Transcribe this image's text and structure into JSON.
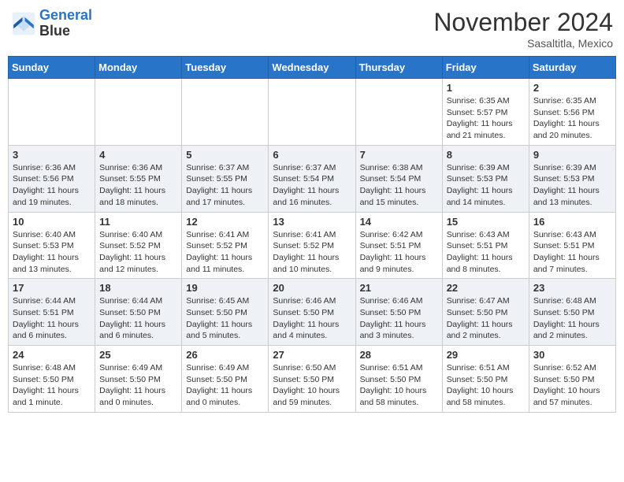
{
  "logo": {
    "line1": "General",
    "line2": "Blue"
  },
  "title": "November 2024",
  "subtitle": "Sasaltitla, Mexico",
  "days_of_week": [
    "Sunday",
    "Monday",
    "Tuesday",
    "Wednesday",
    "Thursday",
    "Friday",
    "Saturday"
  ],
  "weeks": [
    [
      {
        "day": "",
        "info": ""
      },
      {
        "day": "",
        "info": ""
      },
      {
        "day": "",
        "info": ""
      },
      {
        "day": "",
        "info": ""
      },
      {
        "day": "",
        "info": ""
      },
      {
        "day": "1",
        "info": "Sunrise: 6:35 AM\nSunset: 5:57 PM\nDaylight: 11 hours and 21 minutes."
      },
      {
        "day": "2",
        "info": "Sunrise: 6:35 AM\nSunset: 5:56 PM\nDaylight: 11 hours and 20 minutes."
      }
    ],
    [
      {
        "day": "3",
        "info": "Sunrise: 6:36 AM\nSunset: 5:56 PM\nDaylight: 11 hours and 19 minutes."
      },
      {
        "day": "4",
        "info": "Sunrise: 6:36 AM\nSunset: 5:55 PM\nDaylight: 11 hours and 18 minutes."
      },
      {
        "day": "5",
        "info": "Sunrise: 6:37 AM\nSunset: 5:55 PM\nDaylight: 11 hours and 17 minutes."
      },
      {
        "day": "6",
        "info": "Sunrise: 6:37 AM\nSunset: 5:54 PM\nDaylight: 11 hours and 16 minutes."
      },
      {
        "day": "7",
        "info": "Sunrise: 6:38 AM\nSunset: 5:54 PM\nDaylight: 11 hours and 15 minutes."
      },
      {
        "day": "8",
        "info": "Sunrise: 6:39 AM\nSunset: 5:53 PM\nDaylight: 11 hours and 14 minutes."
      },
      {
        "day": "9",
        "info": "Sunrise: 6:39 AM\nSunset: 5:53 PM\nDaylight: 11 hours and 13 minutes."
      }
    ],
    [
      {
        "day": "10",
        "info": "Sunrise: 6:40 AM\nSunset: 5:53 PM\nDaylight: 11 hours and 13 minutes."
      },
      {
        "day": "11",
        "info": "Sunrise: 6:40 AM\nSunset: 5:52 PM\nDaylight: 11 hours and 12 minutes."
      },
      {
        "day": "12",
        "info": "Sunrise: 6:41 AM\nSunset: 5:52 PM\nDaylight: 11 hours and 11 minutes."
      },
      {
        "day": "13",
        "info": "Sunrise: 6:41 AM\nSunset: 5:52 PM\nDaylight: 11 hours and 10 minutes."
      },
      {
        "day": "14",
        "info": "Sunrise: 6:42 AM\nSunset: 5:51 PM\nDaylight: 11 hours and 9 minutes."
      },
      {
        "day": "15",
        "info": "Sunrise: 6:43 AM\nSunset: 5:51 PM\nDaylight: 11 hours and 8 minutes."
      },
      {
        "day": "16",
        "info": "Sunrise: 6:43 AM\nSunset: 5:51 PM\nDaylight: 11 hours and 7 minutes."
      }
    ],
    [
      {
        "day": "17",
        "info": "Sunrise: 6:44 AM\nSunset: 5:51 PM\nDaylight: 11 hours and 6 minutes."
      },
      {
        "day": "18",
        "info": "Sunrise: 6:44 AM\nSunset: 5:50 PM\nDaylight: 11 hours and 6 minutes."
      },
      {
        "day": "19",
        "info": "Sunrise: 6:45 AM\nSunset: 5:50 PM\nDaylight: 11 hours and 5 minutes."
      },
      {
        "day": "20",
        "info": "Sunrise: 6:46 AM\nSunset: 5:50 PM\nDaylight: 11 hours and 4 minutes."
      },
      {
        "day": "21",
        "info": "Sunrise: 6:46 AM\nSunset: 5:50 PM\nDaylight: 11 hours and 3 minutes."
      },
      {
        "day": "22",
        "info": "Sunrise: 6:47 AM\nSunset: 5:50 PM\nDaylight: 11 hours and 2 minutes."
      },
      {
        "day": "23",
        "info": "Sunrise: 6:48 AM\nSunset: 5:50 PM\nDaylight: 11 hours and 2 minutes."
      }
    ],
    [
      {
        "day": "24",
        "info": "Sunrise: 6:48 AM\nSunset: 5:50 PM\nDaylight: 11 hours and 1 minute."
      },
      {
        "day": "25",
        "info": "Sunrise: 6:49 AM\nSunset: 5:50 PM\nDaylight: 11 hours and 0 minutes."
      },
      {
        "day": "26",
        "info": "Sunrise: 6:49 AM\nSunset: 5:50 PM\nDaylight: 11 hours and 0 minutes."
      },
      {
        "day": "27",
        "info": "Sunrise: 6:50 AM\nSunset: 5:50 PM\nDaylight: 10 hours and 59 minutes."
      },
      {
        "day": "28",
        "info": "Sunrise: 6:51 AM\nSunset: 5:50 PM\nDaylight: 10 hours and 58 minutes."
      },
      {
        "day": "29",
        "info": "Sunrise: 6:51 AM\nSunset: 5:50 PM\nDaylight: 10 hours and 58 minutes."
      },
      {
        "day": "30",
        "info": "Sunrise: 6:52 AM\nSunset: 5:50 PM\nDaylight: 10 hours and 57 minutes."
      }
    ]
  ]
}
